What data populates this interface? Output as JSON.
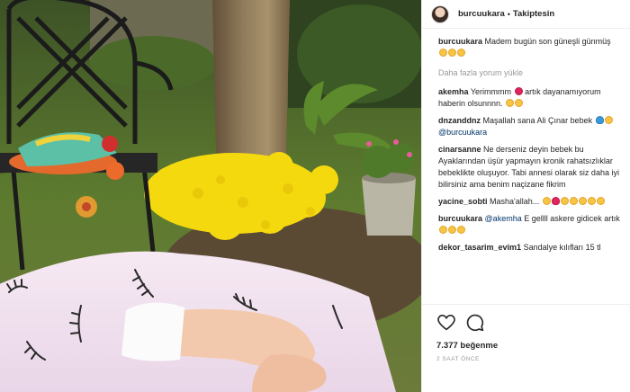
{
  "post": {
    "author": "burcuukara",
    "follow_status": "Takiptesin",
    "separator": "•",
    "caption_user": "burcuukara",
    "caption_text": "Madem bugün son güneşli günmüş",
    "load_more": "Daha fazla yorum yükle",
    "likes": "7.377 beğenme",
    "time": "2 SAAT ÖNCE"
  },
  "comments": [
    {
      "user": "akemha",
      "text_a": "Yerimmmm",
      "text_b": "artık dayanamıyorum haberin olsunnnn."
    },
    {
      "user": "dnzanddnz",
      "text_a": "Maşallah sana Ali Çınar bebek",
      "mention": "@burcuukara"
    },
    {
      "user": "cinarsanne",
      "text_a": "Ne derseniz deyin bebek bu Ayaklarından üşür yapmayın kronik rahatsızlıklar bebeklikte oluşuyor. Tabi annesi olarak siz daha iyi bilirsiniz ama benim naçizane fikrim"
    },
    {
      "user": "yacine_sobti",
      "text_a": "Masha'allah..."
    },
    {
      "user": "burcuukara",
      "mention": "@akemha",
      "text_a": "E gellll askere gidicek artık"
    },
    {
      "user": "dekor_tasarim_evim1",
      "text_a": "Sandalye kılıfları 15 tl"
    }
  ],
  "icons": {
    "like": "heart-outline-icon",
    "comment": "speech-bubble-icon"
  },
  "colors": {
    "link": "#003569",
    "muted": "#999999",
    "text": "#262626",
    "divider": "#efefef"
  }
}
